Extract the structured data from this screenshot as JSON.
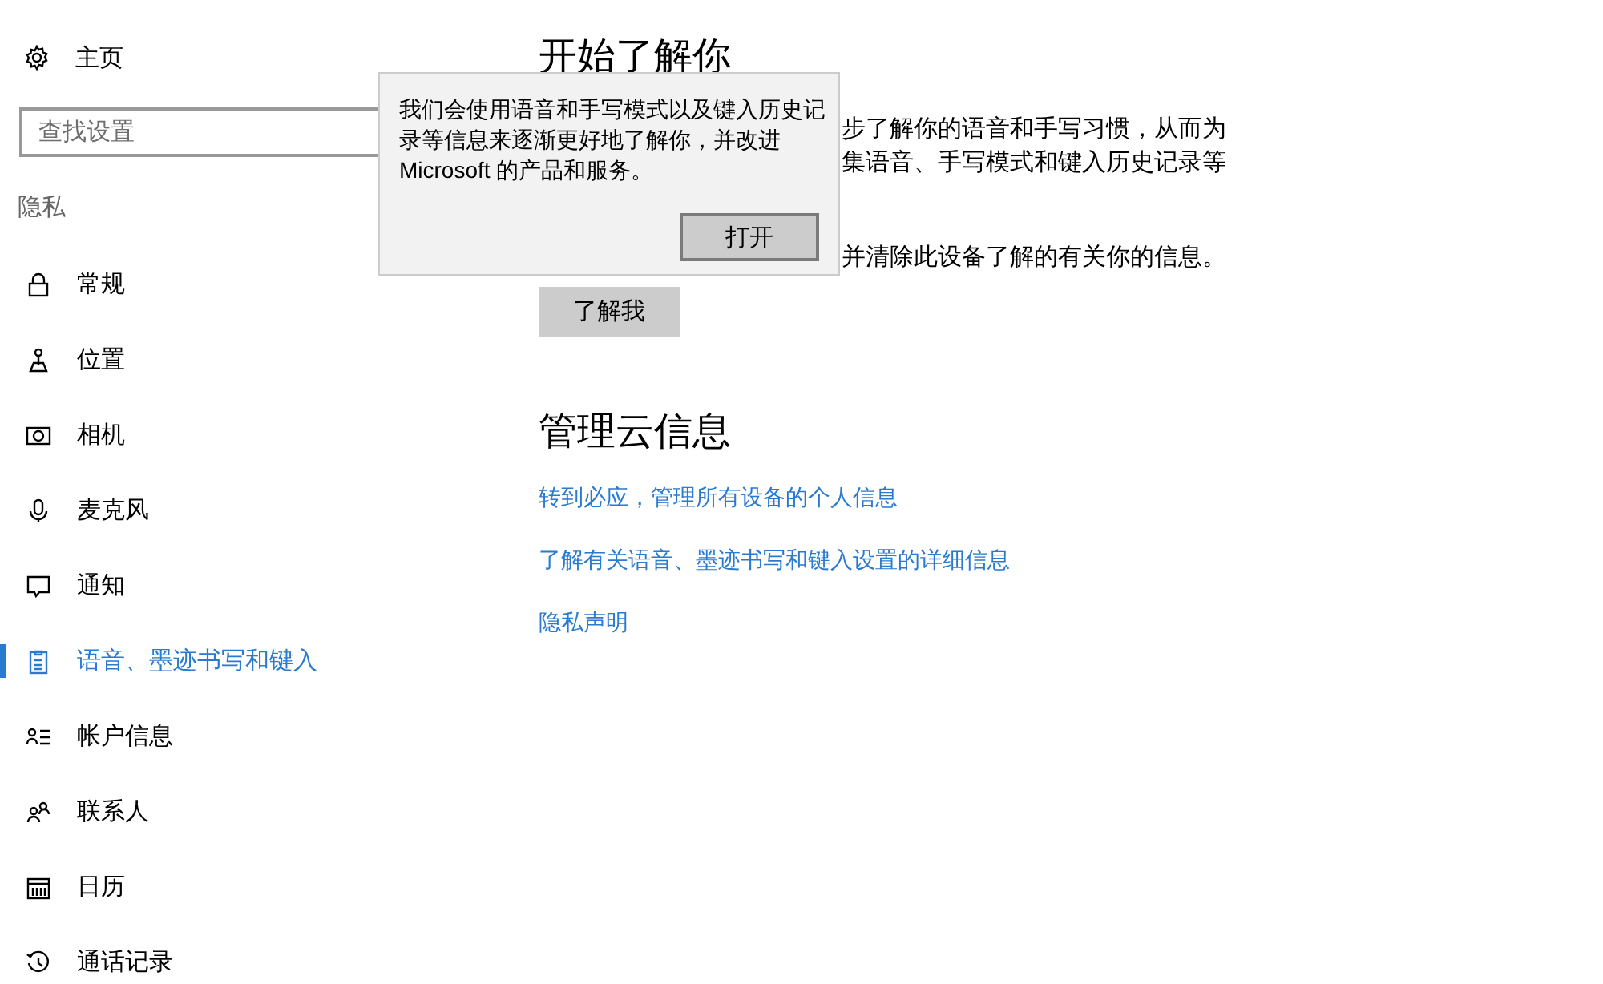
{
  "sidebar": {
    "home": {
      "label": "主页"
    },
    "search": {
      "placeholder": "查找设置"
    },
    "section": "隐私",
    "items": [
      {
        "label": "常规",
        "selected": false
      },
      {
        "label": "位置",
        "selected": false
      },
      {
        "label": "相机",
        "selected": false
      },
      {
        "label": "麦克风",
        "selected": false
      },
      {
        "label": "通知",
        "selected": false
      },
      {
        "label": "语音、墨迹书写和键入",
        "selected": true
      },
      {
        "label": "帐户信息",
        "selected": false
      },
      {
        "label": "联系人",
        "selected": false
      },
      {
        "label": "日历",
        "selected": false
      },
      {
        "label": "通话记录",
        "selected": false
      }
    ]
  },
  "main": {
    "title": "开始了解你",
    "paragraph_lines": [
      "步了解你的语音和手写习惯，从而为",
      "集语音、手写模式和键入历史记录等"
    ],
    "note": "并清除此设备了解的有关你的信息。",
    "button": "了解我",
    "cloud": {
      "title": "管理云信息",
      "links": [
        "转到必应，管理所有设备的个人信息",
        "了解有关语音、墨迹书写和键入设置的详细信息",
        "隐私声明"
      ]
    }
  },
  "popup": {
    "text": "我们会使用语音和手写模式以及键入历史记录等信息来逐渐更好地了解你，并改进 Microsoft 的产品和服务。",
    "button": "打开"
  }
}
